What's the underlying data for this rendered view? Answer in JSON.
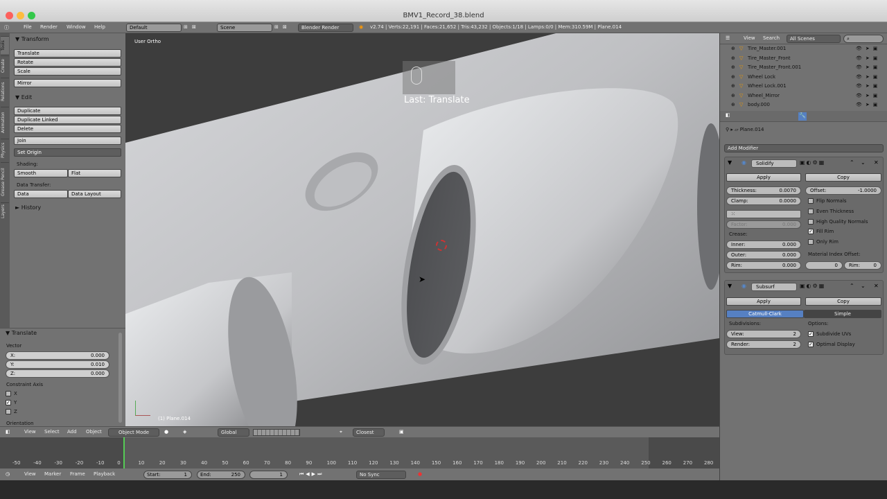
{
  "window": {
    "title": "BMV1_Record_38.blend"
  },
  "infobar": {
    "menus": [
      "File",
      "Render",
      "Window",
      "Help"
    ],
    "layout": "Default",
    "scene": "Scene",
    "engine": "Blender Render",
    "stats": "v2.74 | Verts:22,191 | Faces:21,652 | Tris:43,232 | Objects:1/18 | Lamps:0/0 | Mem:310.59M | Plane.014"
  },
  "lefttabs": [
    "Tools",
    "Create",
    "Relations",
    "Animation",
    "Physics",
    "Grease Pencil",
    "Layers"
  ],
  "toolshelf": {
    "transform_header": "Transform",
    "translate": "Translate",
    "rotate": "Rotate",
    "scale": "Scale",
    "mirror": "Mirror",
    "edit_header": "Edit",
    "duplicate": "Duplicate",
    "duplicate_linked": "Duplicate Linked",
    "delete": "Delete",
    "join": "Join",
    "set_origin": "Set Origin",
    "shading_label": "Shading:",
    "smooth": "Smooth",
    "flat": "Flat",
    "data_transfer_label": "Data Transfer:",
    "data": "Data",
    "data_layout": "Data Layout",
    "history_header": "History"
  },
  "redo": {
    "header": "Translate",
    "vector_label": "Vector",
    "x_label": "X:",
    "x": "0.000",
    "y_label": "Y:",
    "y": "0.010",
    "z_label": "Z:",
    "z": "0.000",
    "constraint_label": "Constraint Axis",
    "cx": "X",
    "cy": "Y",
    "cz": "Z",
    "orientation_label": "Orientation"
  },
  "viewport": {
    "view_label": "User Ortho",
    "hud_text": "Last: Translate",
    "object_label": "(1) Plane.014"
  },
  "vpheader": {
    "view": "View",
    "select": "Select",
    "add": "Add",
    "object": "Object",
    "mode": "Object Mode",
    "orientation": "Global",
    "snap": "Closest"
  },
  "timeline": {
    "ticks": [
      "-50",
      "-40",
      "-30",
      "-20",
      "-10",
      "0",
      "10",
      "20",
      "30",
      "40",
      "50",
      "60",
      "70",
      "80",
      "90",
      "100",
      "110",
      "120",
      "130",
      "140",
      "150",
      "160",
      "170",
      "180",
      "190",
      "200",
      "210",
      "220",
      "230",
      "240",
      "250",
      "260",
      "270",
      "280"
    ],
    "current_frame": 0
  },
  "tlheader": {
    "view": "View",
    "marker": "Marker",
    "frame": "Frame",
    "playback": "Playback",
    "start_label": "Start:",
    "start": "1",
    "end_label": "End:",
    "end": "250",
    "current": "1",
    "sync": "No Sync"
  },
  "outliner": {
    "view": "View",
    "search": "Search",
    "scenes": "All Scenes",
    "items": [
      "Tire_Master.001",
      "Tire_Master_Front",
      "Tire_Master_Front.001",
      "Wheel Lock",
      "Wheel Lock.001",
      "Wheel_Mirror",
      "body.000"
    ]
  },
  "properties": {
    "object_name": "Plane.014",
    "add_modifier": "Add Modifier",
    "solidify": {
      "name": "Solidify",
      "apply": "Apply",
      "copy": "Copy",
      "thickness_label": "Thickness:",
      "thickness": "0.0070",
      "offset_label": "Offset:",
      "offset": "-1.0000",
      "clamp_label": "Clamp:",
      "clamp": "0.0000",
      "factor_label": "Factor:",
      "factor": "0.000",
      "crease_label": "Crease:",
      "inner_label": "Inner:",
      "inner": "0.000",
      "outer_label": "Outer:",
      "outer": "0.000",
      "rim_label": "Rim:",
      "rim": "0.000",
      "flip_normals": "Flip Normals",
      "even_thickness": "Even Thickness",
      "high_quality_normals": "High Quality Normals",
      "fill_rim": "Fill Rim",
      "only_rim": "Only Rim",
      "material_offset_label": "Material Index Offset:",
      "mat_offset": "0",
      "mat_rim_label": "Rim:",
      "mat_rim": "0"
    },
    "subsurf": {
      "name": "Subsurf",
      "apply": "Apply",
      "copy": "Copy",
      "catmull": "Catmull-Clark",
      "simple": "Simple",
      "subdivisions_label": "Subdivisions:",
      "view_label": "View:",
      "view": "2",
      "render_label": "Render:",
      "render": "2",
      "options_label": "Options:",
      "subdivide_uvs": "Subdivide UVs",
      "optimal_display": "Optimal Display"
    }
  }
}
